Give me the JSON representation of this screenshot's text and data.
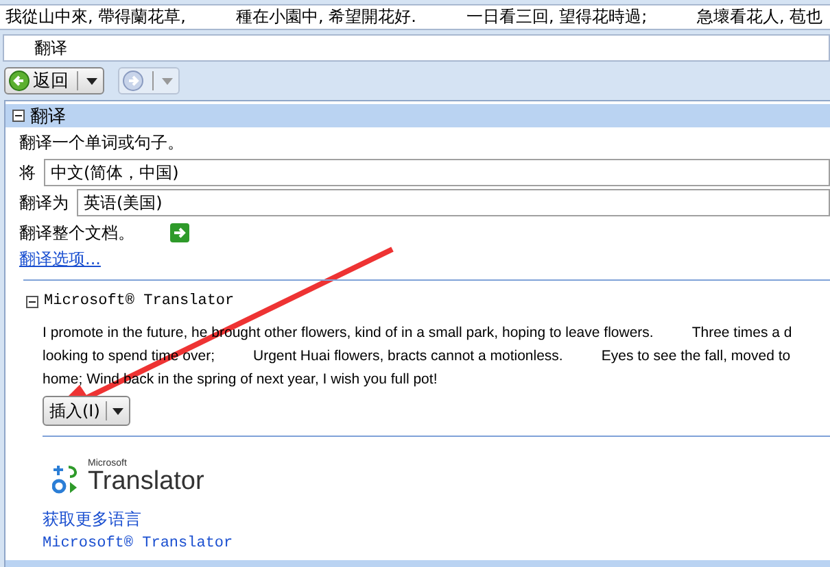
{
  "text_strip": [
    "我從山中來, 帶得蘭花草,",
    "種在小園中, 希望開花好.",
    "一日看三回, 望得花時過;",
    "急壞看花人, 苞也"
  ],
  "search": {
    "value": "翻译"
  },
  "toolbar": {
    "back": {
      "label": "返回"
    },
    "forward": {
      "disabled": true
    }
  },
  "panel": {
    "title": "翻译",
    "expanded": true,
    "intro": "翻译一个单词或句子。",
    "fields": [
      {
        "label": "将",
        "value": "中文(简体，中国)"
      },
      {
        "label": "翻译为",
        "value": "英语(美国)"
      }
    ],
    "document_label": "翻译整个文档。",
    "options_link": "翻译选项...",
    "service": {
      "title": "Microsoft® Translator",
      "expanded": true,
      "lines": [
        [
          "I promote in the future, he brought other flowers, kind of in a small park, hoping to leave flowers.",
          "Three times a d"
        ],
        [
          "looking to spend time over;",
          "Urgent Huai flowers, bracts cannot a motionless.",
          "Eyes to see the fall, moved to"
        ],
        [
          "home; Wind back in the spring of next year, I wish you full pot!"
        ]
      ],
      "insert_button": "插入(I)",
      "logo": {
        "brand": "Microsoft",
        "product": "Translator"
      },
      "more_link": "获取更多语言",
      "credit_link": "Microsoft® Translator"
    }
  }
}
